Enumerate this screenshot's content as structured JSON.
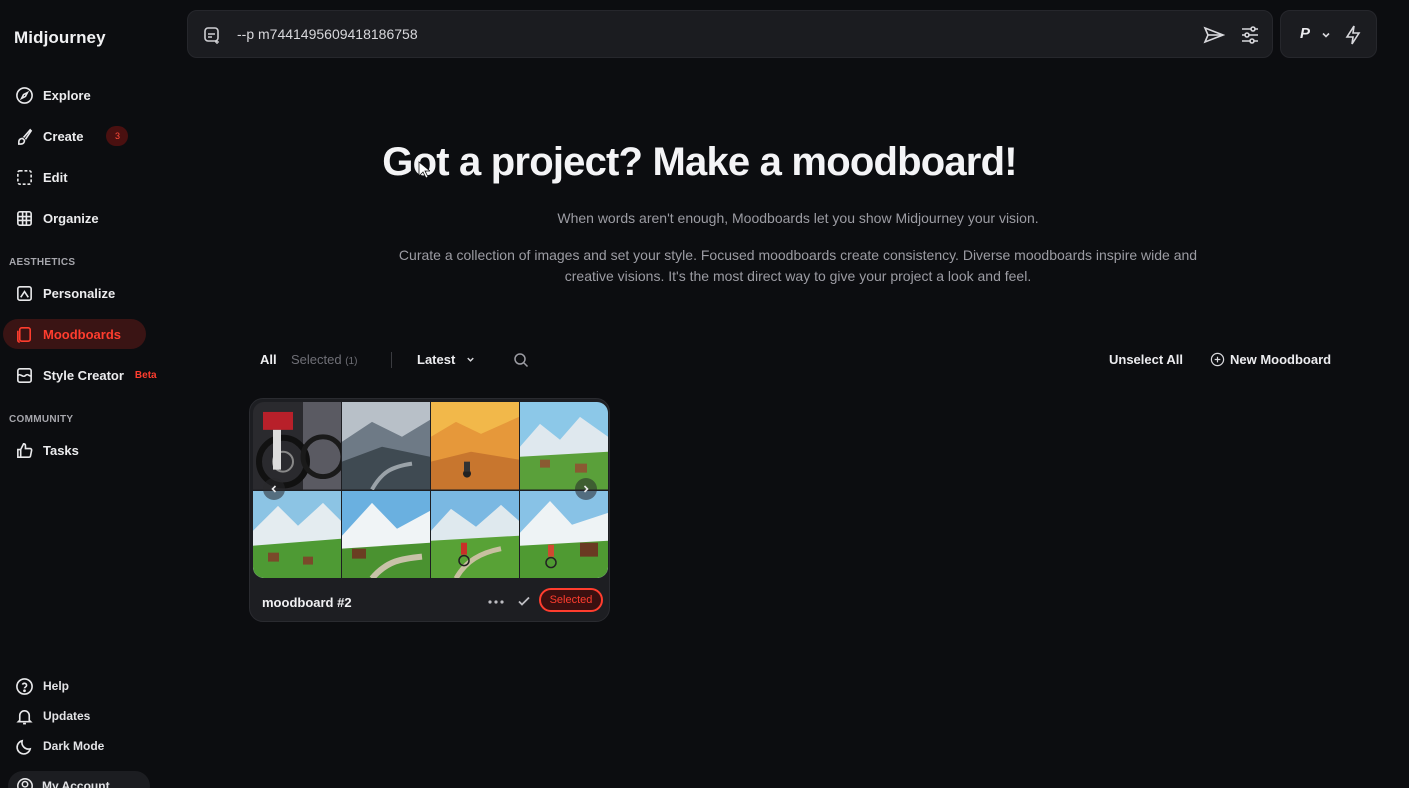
{
  "brand": "Midjourney",
  "sidebar": {
    "items": [
      {
        "label": "Explore",
        "icon": "compass-icon"
      },
      {
        "label": "Create",
        "icon": "brush-icon",
        "badge": "3"
      },
      {
        "label": "Edit",
        "icon": "edit-icon"
      },
      {
        "label": "Organize",
        "icon": "grid-icon"
      }
    ],
    "aesthetics_label": "AESTHETICS",
    "aesthetics": [
      {
        "label": "Personalize",
        "icon": "personalize-icon"
      },
      {
        "label": "Moodboards",
        "icon": "moodboard-icon",
        "active": true
      },
      {
        "label": "Style Creator",
        "icon": "palette-icon",
        "tag": "Beta"
      }
    ],
    "community_label": "COMMUNITY",
    "community": [
      {
        "label": "Tasks",
        "icon": "thumbs-up-icon"
      }
    ],
    "bottom": [
      {
        "label": "Help",
        "icon": "help-icon"
      },
      {
        "label": "Updates",
        "icon": "bell-icon"
      },
      {
        "label": "Dark Mode",
        "icon": "moon-icon"
      }
    ],
    "account_label": "My Account"
  },
  "prompt": {
    "value": "--p m7441495609418186758"
  },
  "mode": {
    "label": "P"
  },
  "hero": {
    "title": "Got a project? Make a moodboard!",
    "subtitle": "When words aren't enough, Moodboards let you show Midjourney your vision.",
    "description": "Curate a collection of images and set your style. Focused moodboards create consistency. Diverse moodboards inspire wide and creative visions. It's the most direct way to give your project a look and feel."
  },
  "filters": {
    "all": "All",
    "selected": "Selected",
    "selected_count": "(1)",
    "sort": "Latest",
    "unselect_all": "Unselect All",
    "new_moodboard": "New Moodboard"
  },
  "moodboard": {
    "title": "moodboard #2",
    "status": "Selected"
  },
  "colors": {
    "accent": "#ff3d2e",
    "background": "#0c0d10"
  }
}
